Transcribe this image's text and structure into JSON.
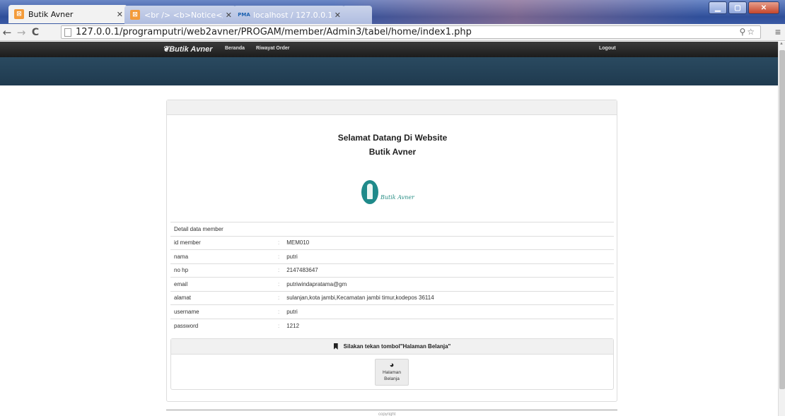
{
  "browser": {
    "tabs": [
      {
        "title": "Butik Avner",
        "active": true
      },
      {
        "title": "<br /> <b>Notice</b>: U",
        "active": false
      },
      {
        "title": "localhost / 127.0.0.1 / data",
        "active": false
      }
    ],
    "pma_badge": "PMA",
    "url": "127.0.0.1/programputri/web2avner/PROGAM/member/Admin3/tabel/home/index1.php",
    "window_buttons": {
      "minimize": "▁",
      "maximize": "▢",
      "close": "✕"
    },
    "nav": {
      "back": "←",
      "forward": "→",
      "reload": "C"
    },
    "toolbar_icons": "⚲☆",
    "menu_icon": "≡"
  },
  "site": {
    "brand": "Butik Avner",
    "nav": {
      "beranda": "Beranda",
      "riwayat": "Riwayat Order",
      "logout": "Logout"
    }
  },
  "main": {
    "welcome_line1": "Selamat Datang Di Website",
    "welcome_line2": "Butik Avner",
    "logo_text": "Butik Avner",
    "detail_title": "Detail data member",
    "rows": [
      {
        "label": "id member",
        "value": "MEM010"
      },
      {
        "label": "nama",
        "value": "putri"
      },
      {
        "label": "no hp",
        "value": "2147483647"
      },
      {
        "label": "email",
        "value": "putriwindapratama@gm"
      },
      {
        "label": "alamat",
        "value": "sulanjan,kota jambi,Kecamatan jambi timur,kodepos 36114"
      },
      {
        "label": "username",
        "value": "putri"
      },
      {
        "label": "password",
        "value": "1212"
      }
    ],
    "colon": ":",
    "instruction": "Silakan tekan tombol\"Halaman Belanja\"",
    "shop_button": {
      "line1": "Halaman",
      "line2": "Belanja"
    }
  },
  "footer": {
    "text": "copyright"
  }
}
